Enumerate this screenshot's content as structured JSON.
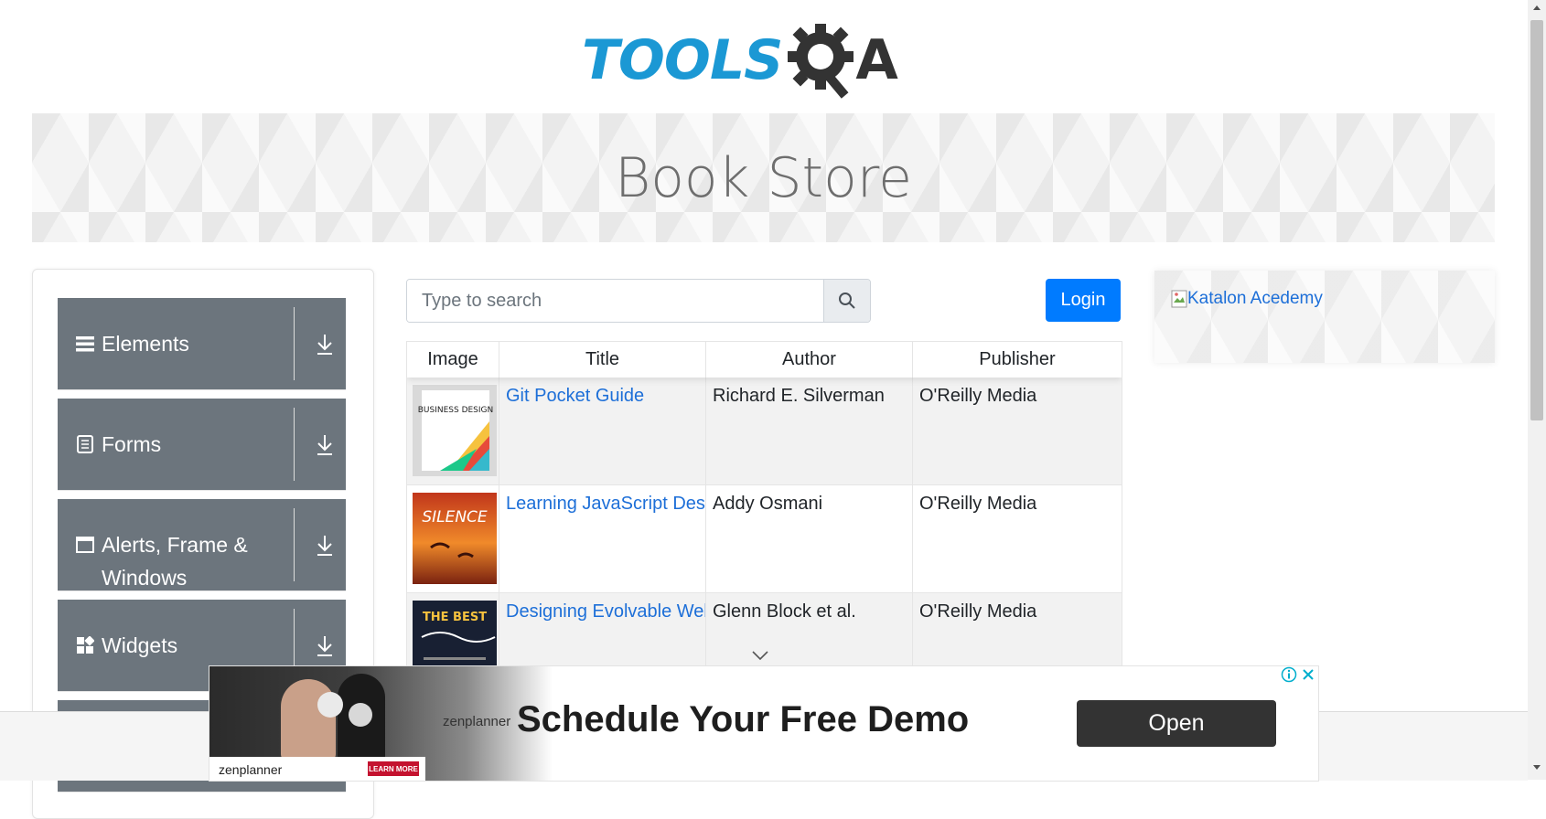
{
  "header": {
    "logo_text": "TOOLS",
    "logo_suffix": "A",
    "banner_title": "Book Store"
  },
  "sidebar": {
    "groups": [
      {
        "label": "Elements",
        "icon": "list-icon"
      },
      {
        "label": "Forms",
        "icon": "document-icon"
      },
      {
        "label": "Alerts, Frame & Windows",
        "icon": "window-icon"
      },
      {
        "label": "Widgets",
        "icon": "widgets-icon"
      }
    ]
  },
  "search": {
    "placeholder": "Type to search",
    "icon": "search-icon"
  },
  "login_label": "Login",
  "table": {
    "columns": [
      "Image",
      "Title",
      "Author",
      "Publisher"
    ],
    "rows": [
      {
        "title": "Git Pocket Guide",
        "author": "Richard E. Silverman",
        "publisher": "O'Reilly Media",
        "cover_text": "BUSINESS DESIGN"
      },
      {
        "title": "Learning JavaScript Design Patterns",
        "author": "Addy Osmani",
        "publisher": "O'Reilly Media",
        "cover_text": "SILENCE"
      },
      {
        "title": "Designing Evolvable Web APIs with ASP.NET",
        "author": "Glenn Block et al.",
        "publisher": "O'Reilly Media",
        "cover_text": "THE BEST"
      }
    ]
  },
  "right_ad": {
    "alt_text": "Katalon Acedemy"
  },
  "bottom_ad": {
    "brand": "zenplanner",
    "headline": "Schedule Your Free Demo",
    "cta": "Open",
    "learn_more": "LEARN MORE"
  },
  "colors": {
    "sidebar_bg": "#6c757d",
    "primary": "#007bff",
    "link": "#1d6fd8",
    "logo_blue": "#1b98d4"
  }
}
